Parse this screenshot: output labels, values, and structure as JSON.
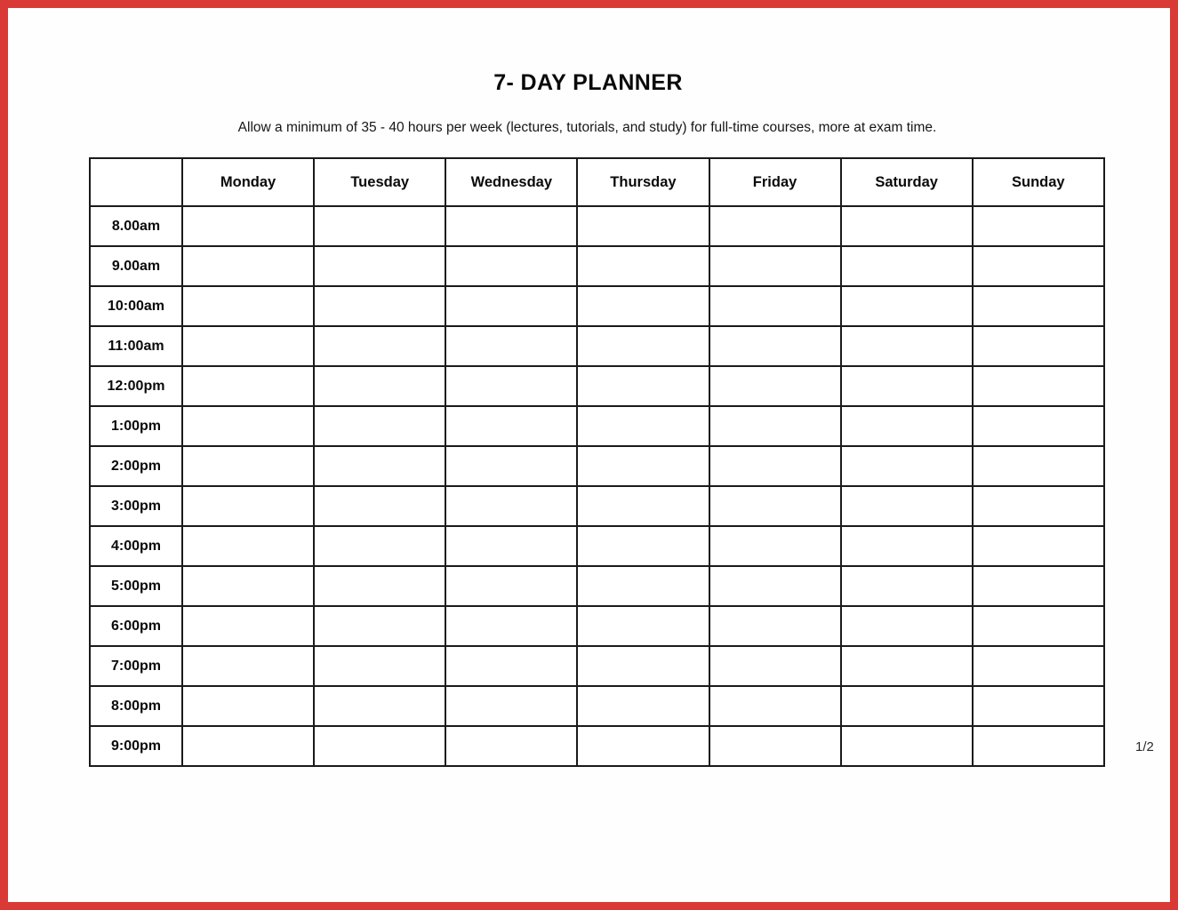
{
  "document": {
    "title": "7- DAY PLANNER",
    "subtitle": "Allow a minimum of 35 - 40 hours per week (lectures, tutorials, and study) for full-time courses, more at exam time.",
    "page_number": "1/2",
    "frame_color": "#d93a35",
    "grid_color": "#1a1a1a",
    "text_color": "#0a0a0a"
  },
  "table": {
    "corner_header": "",
    "day_headers": [
      "Monday",
      "Tuesday",
      "Wednesday",
      "Thursday",
      "Friday",
      "Saturday",
      "Sunday"
    ],
    "time_rows": [
      {
        "time": "8.00am",
        "cells": [
          "",
          "",
          "",
          "",
          "",
          "",
          ""
        ]
      },
      {
        "time": "9.00am",
        "cells": [
          "",
          "",
          "",
          "",
          "",
          "",
          ""
        ]
      },
      {
        "time": "10:00am",
        "cells": [
          "",
          "",
          "",
          "",
          "",
          "",
          ""
        ]
      },
      {
        "time": "11:00am",
        "cells": [
          "",
          "",
          "",
          "",
          "",
          "",
          ""
        ]
      },
      {
        "time": "12:00pm",
        "cells": [
          "",
          "",
          "",
          "",
          "",
          "",
          ""
        ]
      },
      {
        "time": "1:00pm",
        "cells": [
          "",
          "",
          "",
          "",
          "",
          "",
          ""
        ]
      },
      {
        "time": "2:00pm",
        "cells": [
          "",
          "",
          "",
          "",
          "",
          "",
          ""
        ]
      },
      {
        "time": "3:00pm",
        "cells": [
          "",
          "",
          "",
          "",
          "",
          "",
          ""
        ]
      },
      {
        "time": "4:00pm",
        "cells": [
          "",
          "",
          "",
          "",
          "",
          "",
          ""
        ]
      },
      {
        "time": "5:00pm",
        "cells": [
          "",
          "",
          "",
          "",
          "",
          "",
          ""
        ]
      },
      {
        "time": "6:00pm",
        "cells": [
          "",
          "",
          "",
          "",
          "",
          "",
          ""
        ]
      },
      {
        "time": "7:00pm",
        "cells": [
          "",
          "",
          "",
          "",
          "",
          "",
          ""
        ]
      },
      {
        "time": "8:00pm",
        "cells": [
          "",
          "",
          "",
          "",
          "",
          "",
          ""
        ]
      },
      {
        "time": "9:00pm",
        "cells": [
          "",
          "",
          "",
          "",
          "",
          "",
          ""
        ]
      }
    ]
  }
}
